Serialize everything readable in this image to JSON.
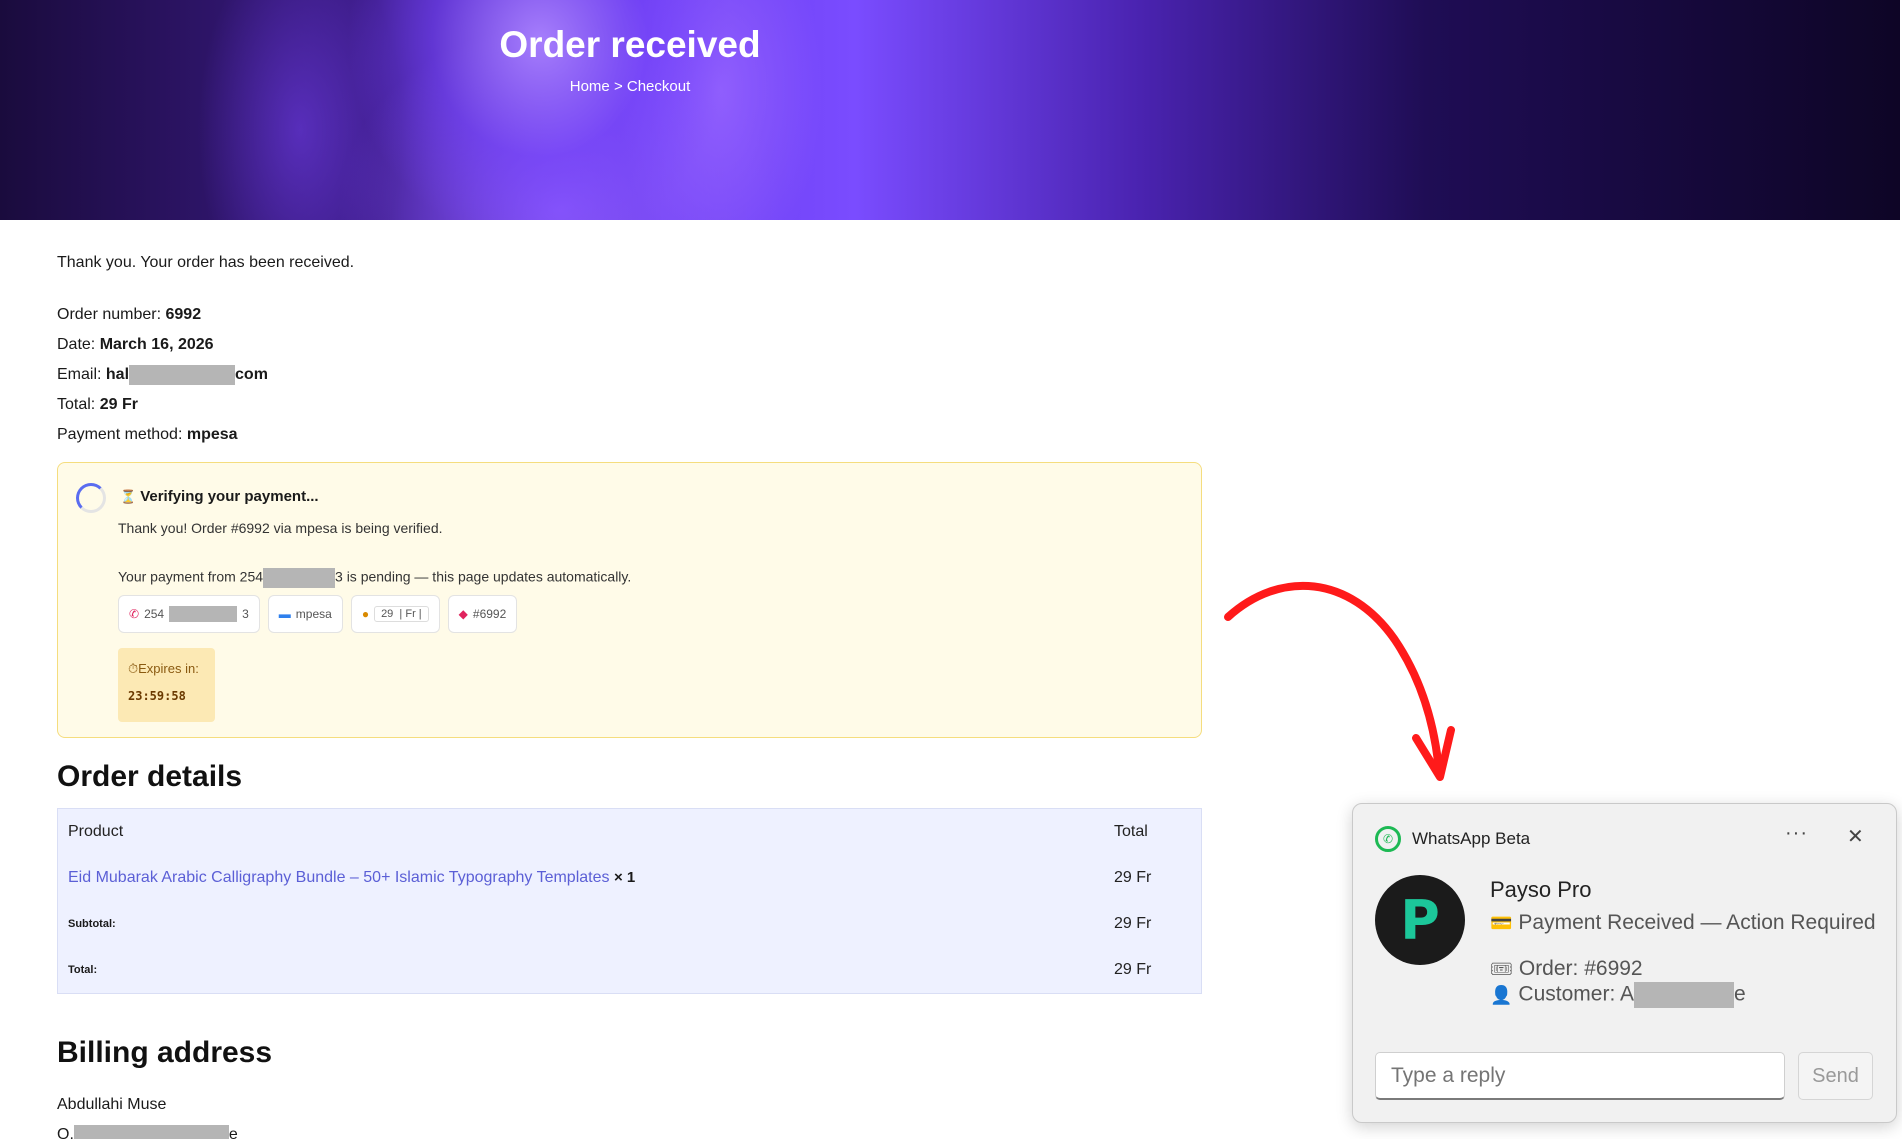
{
  "hero": {
    "title": "Order received",
    "breadcrumb_home": "Home",
    "breadcrumb_sep": ">",
    "breadcrumb_current": "Checkout"
  },
  "order": {
    "thanks": "Thank you. Your order has been received.",
    "number_label": "Order number:",
    "number": "6992",
    "date_label": "Date:",
    "date": "March 16, 2026",
    "email_label": "Email:",
    "email_start": "hal",
    "email_end": "com",
    "total_label": "Total:",
    "total": "29 Fr",
    "payment_label": "Payment method:",
    "payment": "mpesa"
  },
  "verify": {
    "title_icon": "⏳",
    "title": "Verifying your payment...",
    "subtitle": "Thank you! Order #6992 via mpesa is being verified.",
    "pending_start": "Your payment from 254",
    "pending_end": "3 is pending — this page updates automatically.",
    "chip_phone_start": "254",
    "chip_phone_end": "3",
    "chip_method": "mpesa",
    "chip_amount": "29",
    "chip_currency": "Fr",
    "chip_order": "#6992",
    "expires_label": "⏱Expires in:",
    "expires_time": "23:59:58"
  },
  "order_details": {
    "title": "Order details",
    "col_product": "Product",
    "col_total": "Total",
    "product_name": "Eid Mubarak Arabic Calligraphy Bundle – 50+ Islamic Typography Templates",
    "product_qty": "× 1",
    "product_total": "29 Fr",
    "subtotal_label": "Subtotal:",
    "subtotal": "29 Fr",
    "total_label": "Total:",
    "total": "29 Fr"
  },
  "billing": {
    "title": "Billing address",
    "name": "Abdullahi Muse",
    "line2_start": "Q.",
    "line2_end": "e"
  },
  "notification": {
    "app": "WhatsApp Beta",
    "more": "···",
    "close": "✕",
    "sender": "Payso Pro",
    "avatar_letter": "P",
    "line1_icon": "💳",
    "line1": "Payment Received — Action Required",
    "line2_icon": "🎟",
    "line2": "Order: #6992",
    "line3_icon": "👤",
    "line3_start": "Customer: A",
    "line3_end": "e",
    "reply_placeholder": "Type a reply",
    "send": "Send"
  },
  "colors": {
    "accent": "#5b5fd6",
    "whatsapp": "#1db954",
    "arrow": "#ff1a1a"
  }
}
